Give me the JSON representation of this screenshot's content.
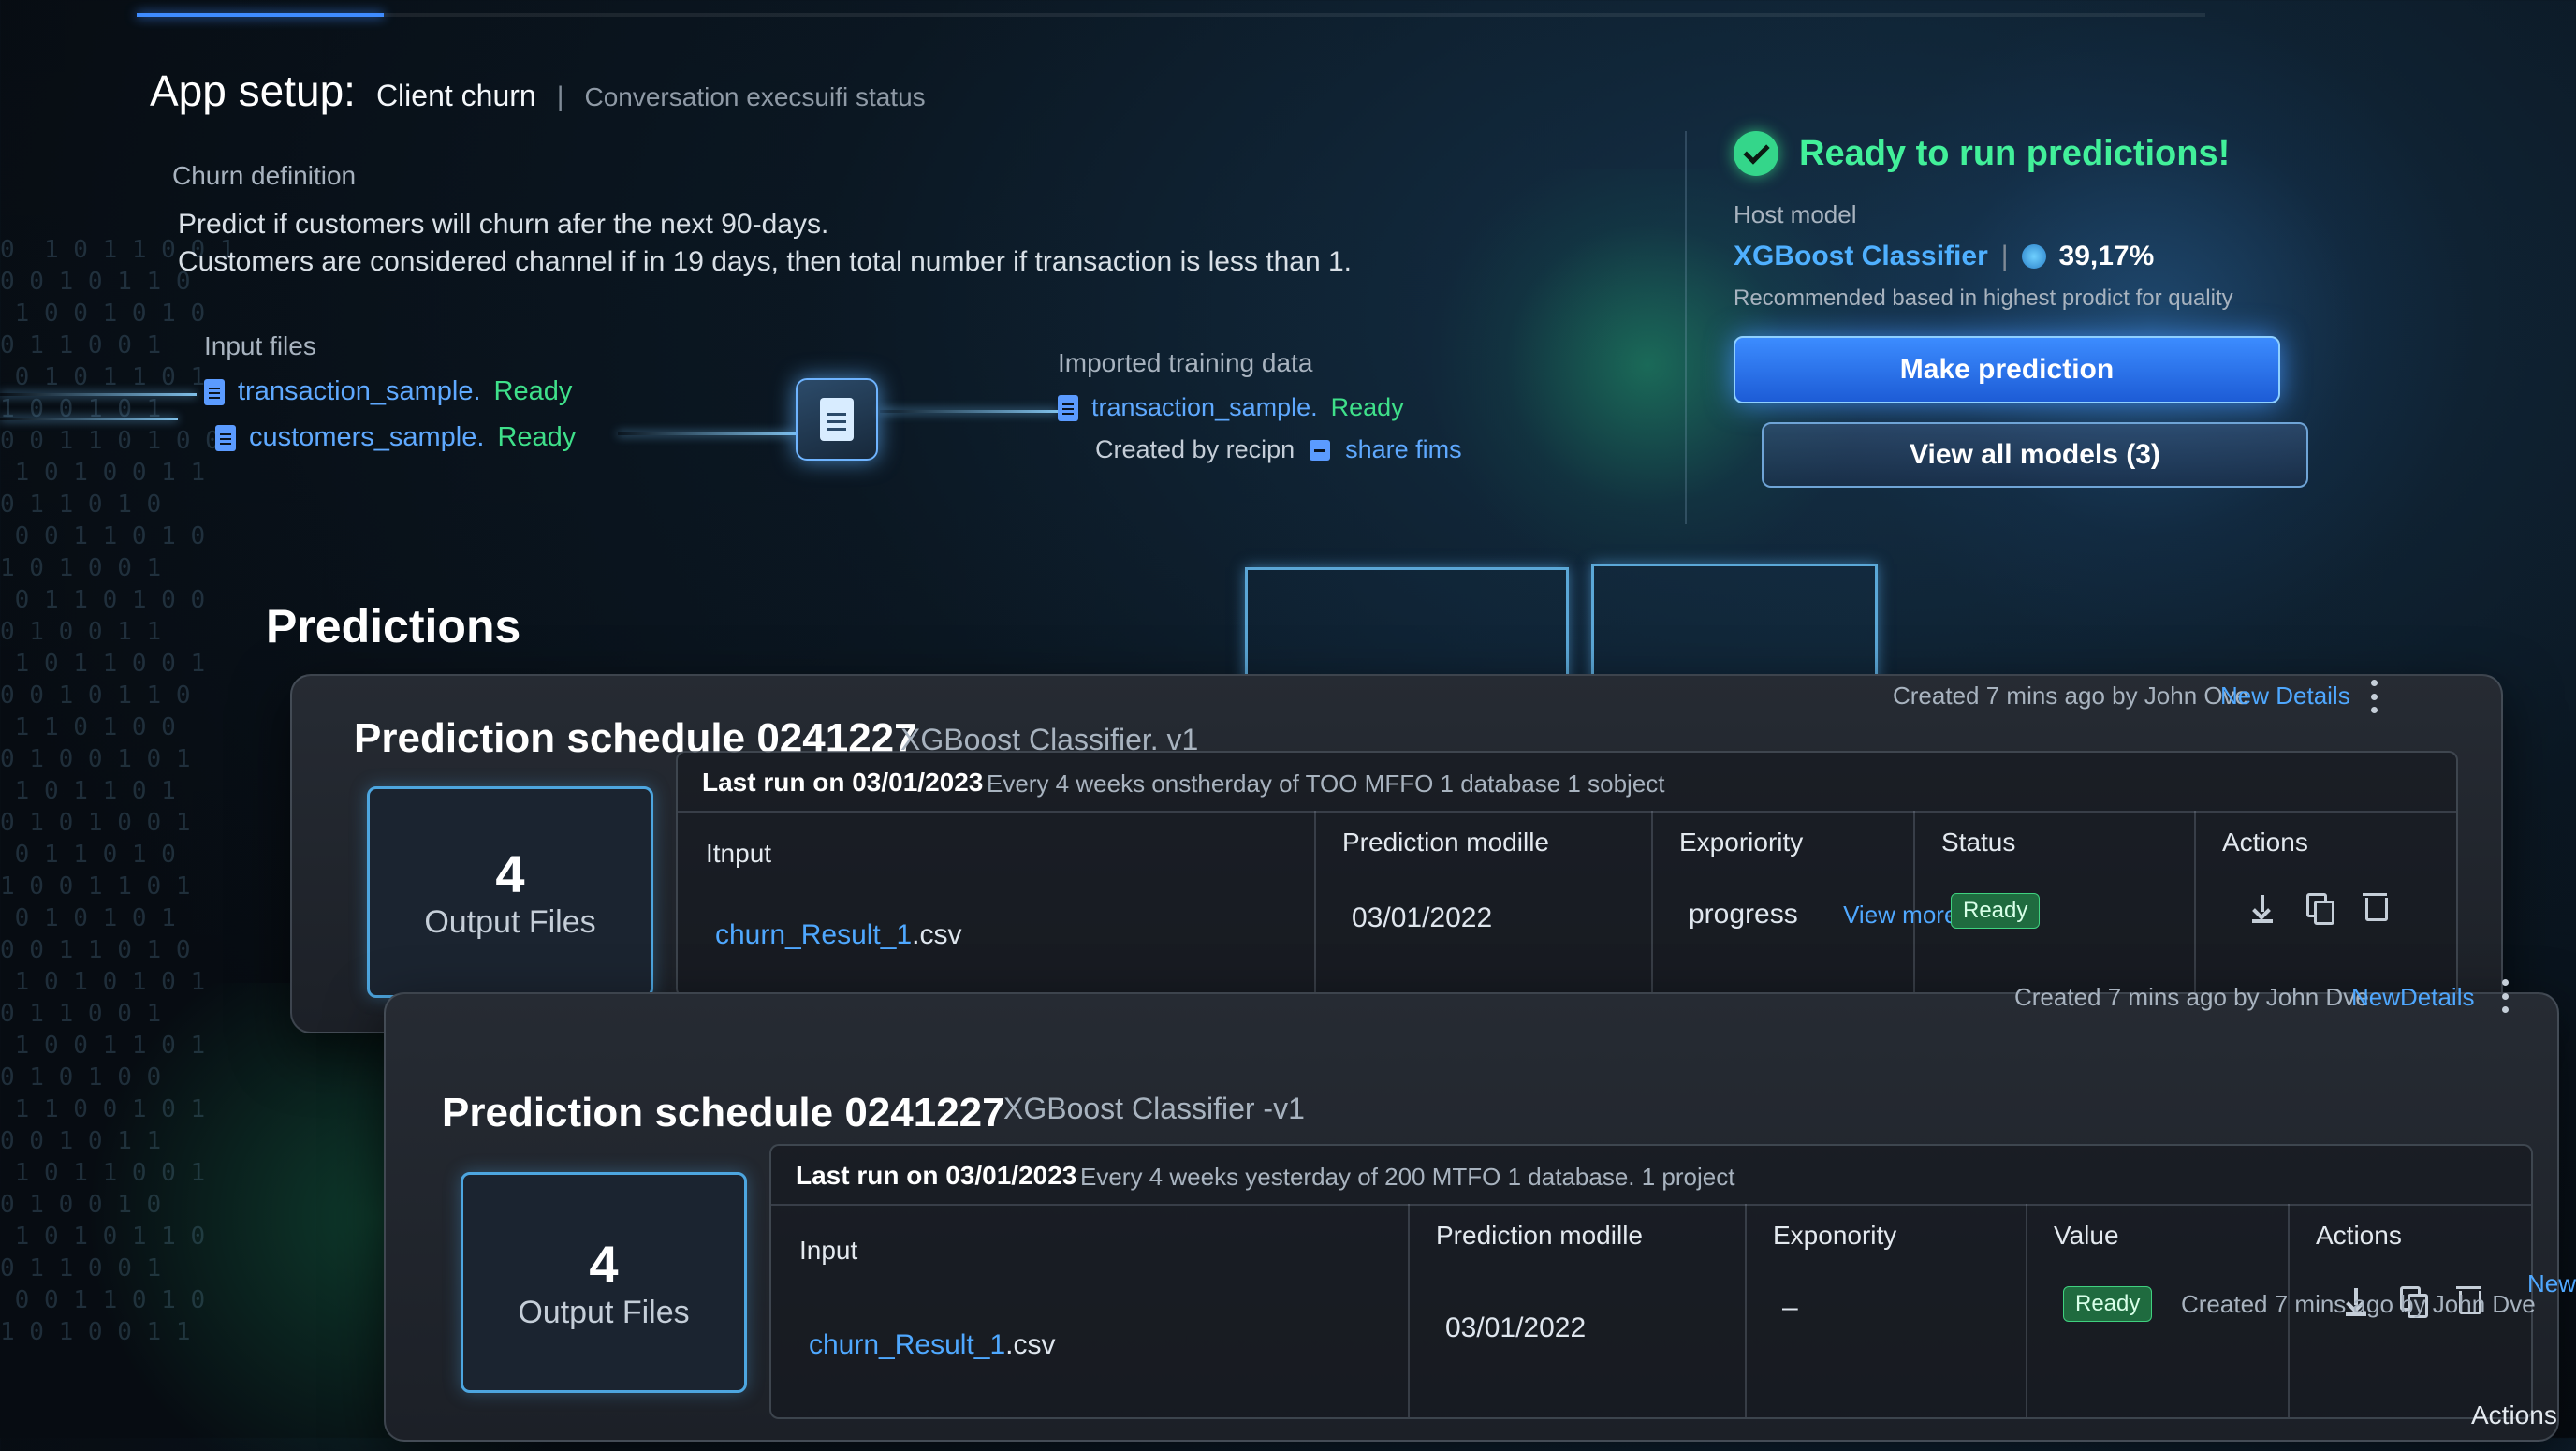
{
  "setup": {
    "title_prefix": "App setup:",
    "app_name": "Client churn",
    "separator": "|",
    "subtitle": "Conversation execsuifi status",
    "churn_label": "Churn definition",
    "churn_line1": "Predict if customers will churn afer the next 90-days.",
    "churn_line2": "Customers are considered channel if in 19 days, then total number if transaction is less than 1."
  },
  "input_files": {
    "label": "Input files",
    "files": [
      {
        "name": "transaction_sample.",
        "status": "Ready"
      },
      {
        "name": "customers_sample.",
        "status": "Ready"
      }
    ]
  },
  "imported": {
    "label": "Imported training data",
    "file_name": "transaction_sample.",
    "file_status": "Ready",
    "created_by": "Created by recipn",
    "share_label": "share fims"
  },
  "ready_panel": {
    "heading": "Ready to run predictions!",
    "host_label": "Host model",
    "model_name": "XGBoost Classifier",
    "separator": "|",
    "score": "39,17%",
    "recommend": "Recommended based in highest prodict for quality",
    "make_prediction": "Make prediction",
    "view_models": "View all models (3)"
  },
  "predictions": {
    "title": "Predictions",
    "cards": [
      {
        "title": "Prediction schedule 0241227",
        "model": "XGBoost Classifier. v1",
        "created": "Created 7 mins ago by John Ove",
        "details_link": "New Details",
        "output_count": "4",
        "output_label": "Output Files",
        "last_run": "Last run on 03/01/2023",
        "last_run_desc": "Every 4 weeks onstherday of TOO MFFO 1 database 1 sobject",
        "headers": {
          "input": "Itnput",
          "prediction": "Prediction modille",
          "exp": "Exporiority",
          "status": "Status",
          "actions": "Actions"
        },
        "csv_link": "churn_Result_1",
        "csv_ext": ".csv",
        "prediction_date": "03/01/2022",
        "exp_value": "progress",
        "view_more": "View more",
        "status_value": "Ready"
      },
      {
        "title": "Prediction schedule 0241227",
        "model": "XGBoost Classifier -v1",
        "created": "Created 7 mins ago by John Dve",
        "details_link": "NewDetails",
        "output_count": "4",
        "output_label": "Output Files",
        "last_run": "Last run on 03/01/2023",
        "last_run_desc": "Every 4 weeks yesterday of 200 MTFO 1 database. 1 project",
        "headers": {
          "input": "Input",
          "prediction": "Prediction modille",
          "exp": "Exponority",
          "status": "Value",
          "actions": "Actions"
        },
        "csv_link": "churn_Result_1",
        "csv_ext": ".csv",
        "prediction_date": "03/01/2022",
        "exp_value": "–",
        "status_value": "Ready"
      }
    ],
    "third_created": "Created 7 mins ago by John Dve",
    "third_link": "New",
    "third_actions": "Actions"
  },
  "colors": {
    "accent": "#3f8cff",
    "ready": "#3fe08a",
    "link": "#4fa8ff",
    "background": "#0b1722"
  },
  "icons": [
    "doc-icon",
    "check-circle-icon",
    "download-icon",
    "copy-icon",
    "trash-icon",
    "kebab-menu-icon",
    "share-icon",
    "score-icon"
  ]
}
